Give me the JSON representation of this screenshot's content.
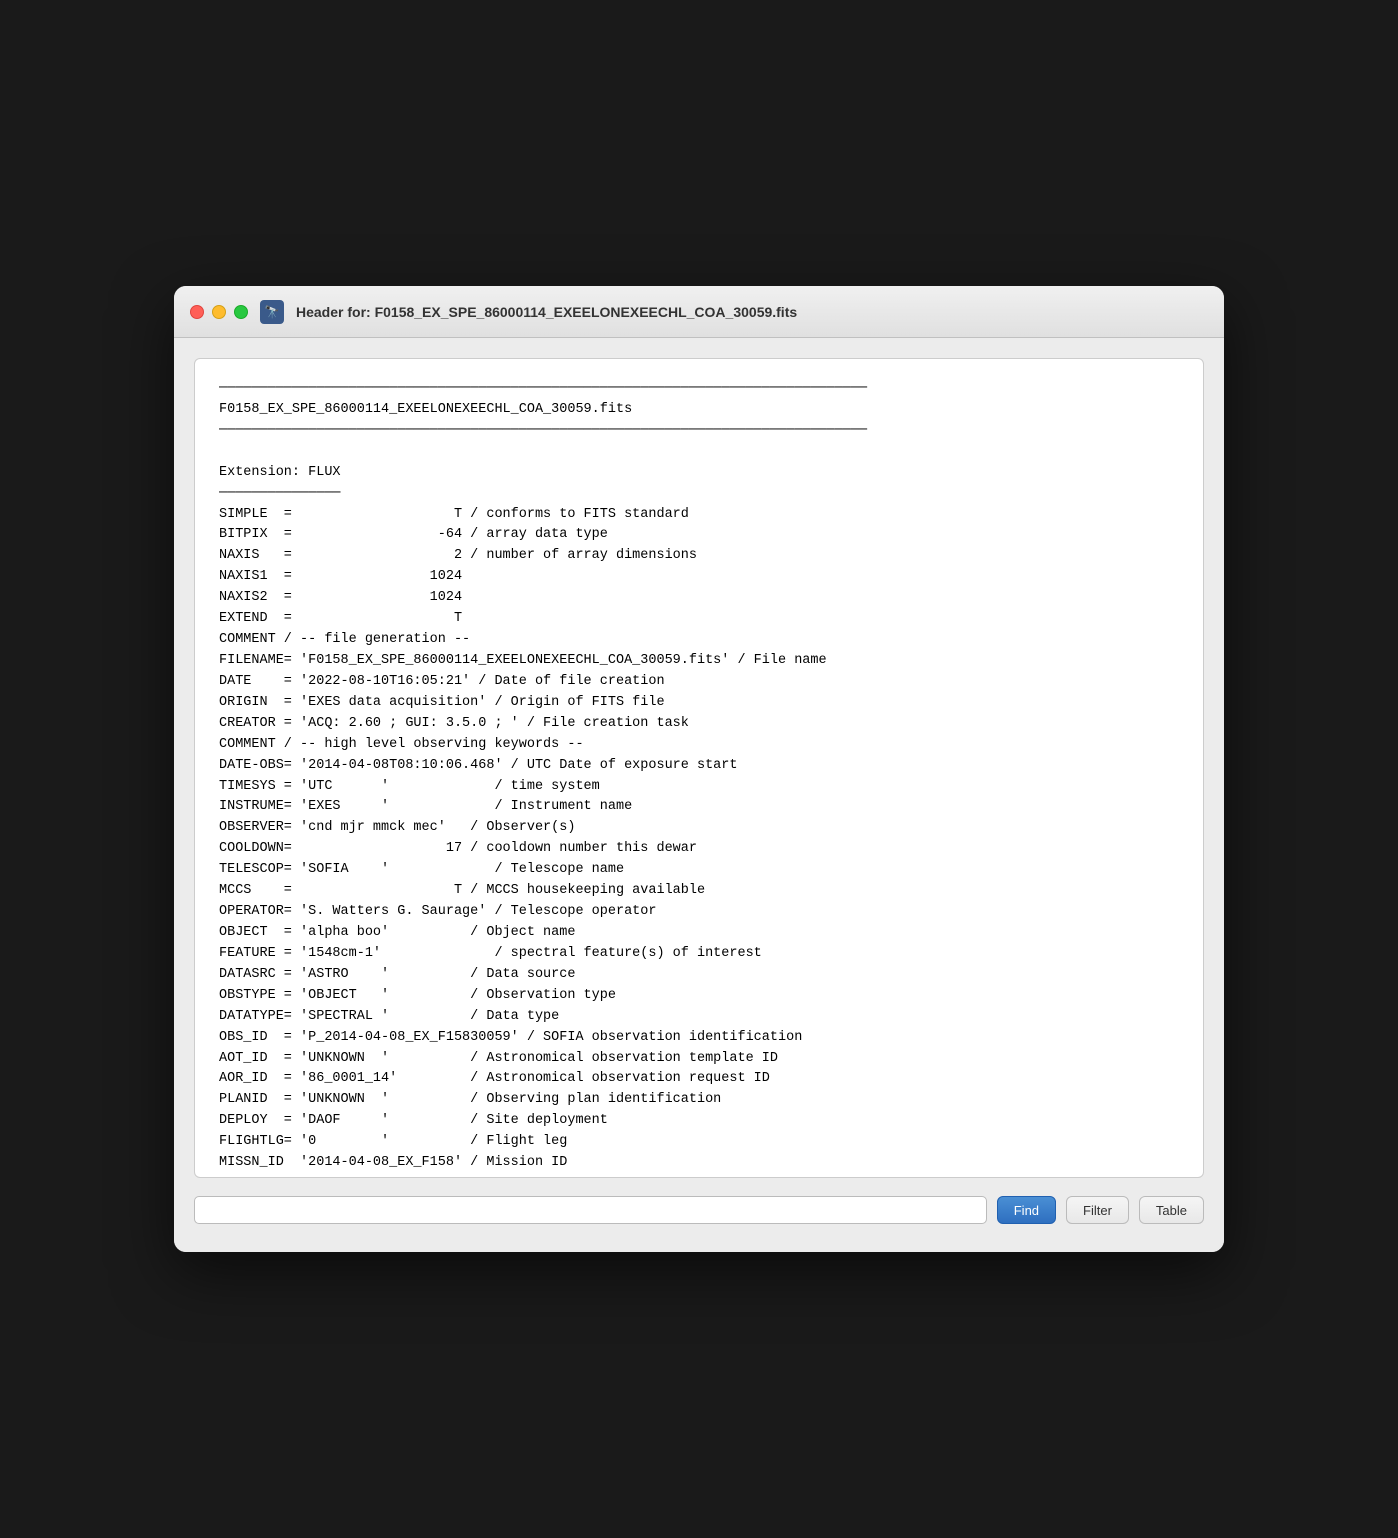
{
  "window": {
    "title": "Header for: F0158_EX_SPE_86000114_EXEELONEXEECHL_COA_30059.fits",
    "icon_label": "🔭"
  },
  "traffic_lights": {
    "close_label": "close",
    "minimize_label": "minimize",
    "maximize_label": "maximize"
  },
  "header_content": "────────────────────────────────────────────────────────────────────────────────\nF0158_EX_SPE_86000114_EXEELONEXEECHL_COA_30059.fits\n────────────────────────────────────────────────────────────────────────────────\n\nExtension: FLUX\n───────────────\nSIMPLE  =                    T / conforms to FITS standard\nBITPIX  =                  -64 / array data type\nNAXIS   =                    2 / number of array dimensions\nNAXIS1  =                 1024\nNAXIS2  =                 1024\nEXTEND  =                    T\nCOMMENT / -- file generation --\nFILENAME= 'F0158_EX_SPE_86000114_EXEELONEXEECHL_COA_30059.fits' / File name\nDATE    = '2022-08-10T16:05:21' / Date of file creation\nORIGIN  = 'EXES data acquisition' / Origin of FITS file\nCREATOR = 'ACQ: 2.60 ; GUI: 3.5.0 ; ' / File creation task\nCOMMENT / -- high level observing keywords --\nDATE-OBS= '2014-04-08T08:10:06.468' / UTC Date of exposure start\nTIMESYS = 'UTC      '             / time system\nINSTRUME= 'EXES     '             / Instrument name\nOBSERVER= 'cnd mjr mmck mec'   / Observer(s)\nCOOLDOWN=                   17 / cooldown number this dewar\nTELESCOP= 'SOFIA    '             / Telescope name\nMCCS    =                    T / MCCS housekeeping available\nOPERATOR= 'S. Watters G. Saurage' / Telescope operator\nOBJECT  = 'alpha boo'          / Object name\nFEATURE = '1548cm-1'              / spectral feature(s) of interest\nDATASRC = 'ASTRO    '          / Data source\nOBSTYPE = 'OBJECT   '          / Observation type\nDATATYPE= 'SPECTRAL '          / Data type\nOBS_ID  = 'P_2014-04-08_EX_F15830059' / SOFIA observation identification\nAOT_ID  = 'UNKNOWN  '          / Astronomical observation template ID\nAOR_ID  = '86_0001_14'         / Astronomical observation request ID\nPLANID  = 'UNKNOWN  '          / Observing plan identification\nDEPLOY  = 'DAOF     '          / Site deployment\nFLIGHTLG= '0        '          / Flight leg\nMISSN_ID  '2014-04-08_EX_F158' / Mission ID",
  "toolbar": {
    "search_placeholder": "",
    "find_label": "Find",
    "filter_label": "Filter",
    "table_label": "Table"
  }
}
